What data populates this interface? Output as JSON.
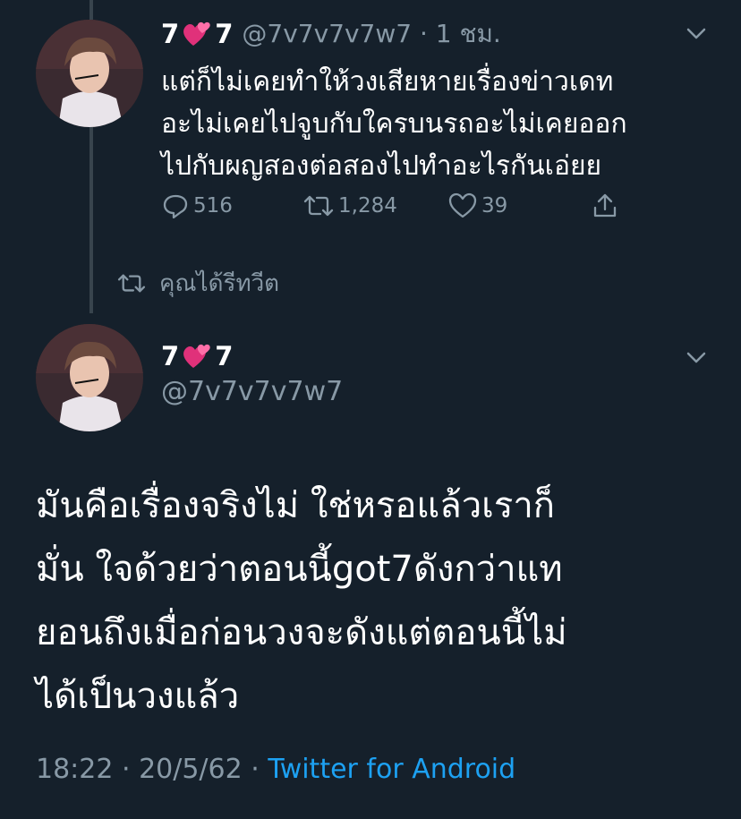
{
  "reply_tweet": {
    "display_name_pre": "7",
    "display_name_post": "7",
    "emoji": "two-hearts-emoji",
    "handle_time": "@7v7v7v7w7 · 1 ชม.",
    "text": "แต่ก็ไม่เคยทำให้วงเสียหายเรื่องข่าวเดท\nอะไม่เคยไปจูบกับใครบนรถอะไม่เคยออก\nไปกับผญสองต่อสองไปทำอะไรกันเอ่ยย",
    "replies": "516",
    "retweets": "1,284",
    "likes": "39"
  },
  "retweet_notice": "คุณได้รีทวีต",
  "main_tweet": {
    "display_name_pre": "7",
    "display_name_post": "7",
    "handle": "@7v7v7v7w7",
    "text": "มันคือเรื่องจริงไม่ ใช่หรอแล้วเราก็\nมั่น ใจด้วยว่าตอนนี้got7ดังกว่าแท\nยอนถึงเมื่อก่อนวงจะดังแต่ตอนนี้ไม่\nได้เป็นวงแล้ว",
    "time": "18:22 · 20/5/62 · ",
    "source": "Twitter for Android"
  },
  "colors": {
    "background": "#15202b",
    "secondary_text": "#8899a6",
    "link": "#1da1f2",
    "thread_line": "#38444d",
    "heart_emoji": "#e0317a"
  }
}
